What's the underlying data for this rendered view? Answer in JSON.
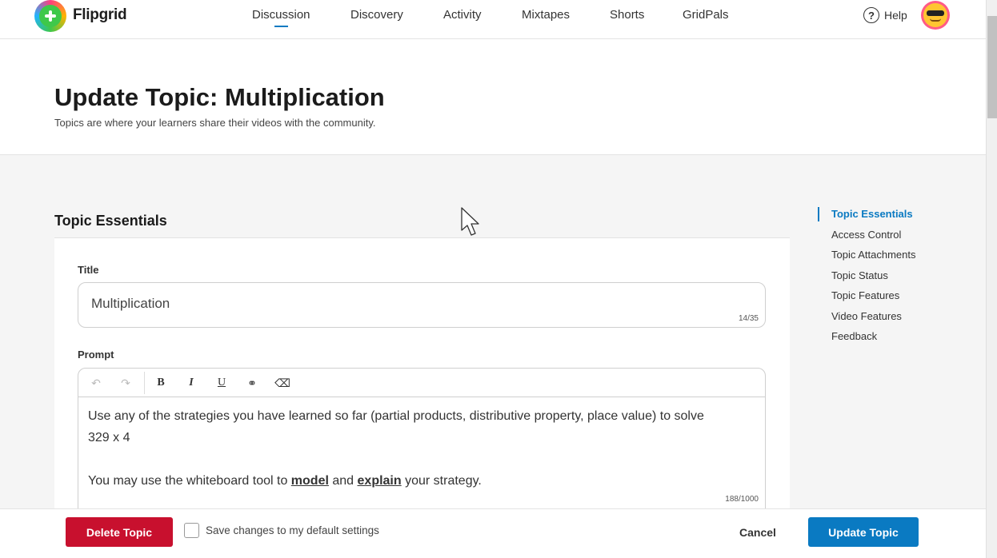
{
  "brand": {
    "name": "Flipgrid"
  },
  "nav": {
    "items": [
      {
        "label": "Discussion",
        "active": true
      },
      {
        "label": "Discovery"
      },
      {
        "label": "Activity"
      },
      {
        "label": "Mixtapes"
      },
      {
        "label": "Shorts"
      },
      {
        "label": "GridPals"
      }
    ],
    "help_label": "Help",
    "help_glyph": "?"
  },
  "header": {
    "title": "Update Topic: Multiplication",
    "subtitle": "Topics are where your learners share their videos with the community."
  },
  "section": {
    "title": "Topic Essentials"
  },
  "form": {
    "title_label": "Title",
    "title_value": "Multiplication",
    "title_counter": "14/35",
    "prompt_label": "Prompt",
    "toolbar": {
      "undo": "↶",
      "redo": "↷",
      "bold": "B",
      "italic": "I",
      "underline": "U",
      "link": "⚭",
      "clear": "⌫"
    },
    "prompt": {
      "line1": "Use any of the strategies you have learned so far (partial products, distributive property, place value) to solve 329 x 4",
      "line2_before": "You may use the whiteboard tool to ",
      "line2_bold1": "model",
      "line2_mid": " and ",
      "line2_bold2": "explain",
      "line2_after": " your strategy."
    },
    "prompt_counter": "188/1000"
  },
  "side_nav": {
    "items": [
      {
        "label": "Topic Essentials",
        "active": true
      },
      {
        "label": "Access Control"
      },
      {
        "label": "Topic Attachments"
      },
      {
        "label": "Topic Status"
      },
      {
        "label": "Topic Features"
      },
      {
        "label": "Video Features"
      },
      {
        "label": "Feedback"
      }
    ]
  },
  "footer": {
    "delete_label": "Delete Topic",
    "checkbox_label": "Save changes to my default settings",
    "cancel_label": "Cancel",
    "update_label": "Update Topic"
  },
  "colors": {
    "accent": "#0a7ac2",
    "danger": "#c8102e"
  }
}
